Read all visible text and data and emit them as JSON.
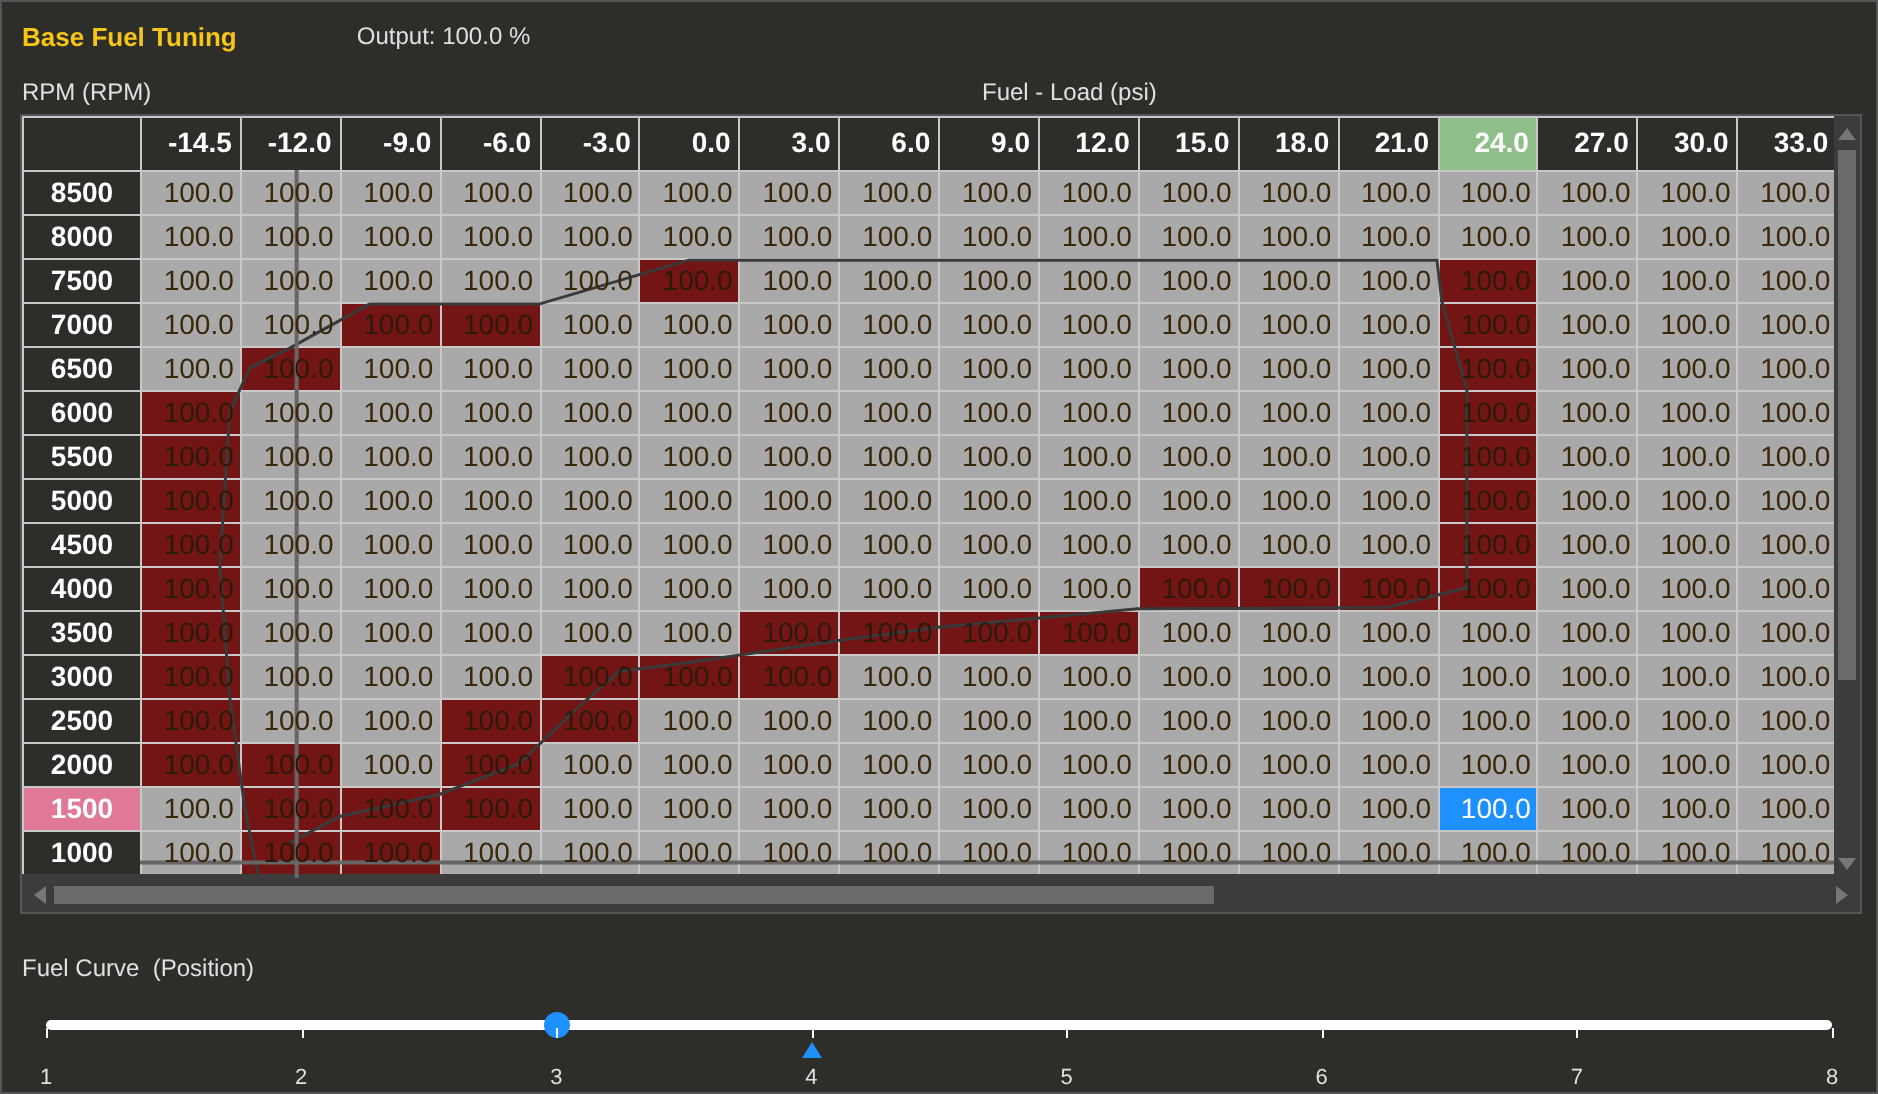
{
  "header": {
    "title": "Base Fuel Tuning",
    "output": "Output: 100.0 %"
  },
  "table": {
    "row_axis": "RPM (RPM)",
    "column_axis": "Fuel - Load (psi)",
    "columns": [
      {
        "label": "-14.5",
        "selected": false
      },
      {
        "label": "-12.0",
        "selected": false
      },
      {
        "label": "-9.0",
        "selected": false
      },
      {
        "label": "-6.0",
        "selected": false
      },
      {
        "label": "-3.0",
        "selected": false
      },
      {
        "label": "0.0",
        "selected": false
      },
      {
        "label": "3.0",
        "selected": false
      },
      {
        "label": "6.0",
        "selected": false
      },
      {
        "label": "9.0",
        "selected": false
      },
      {
        "label": "12.0",
        "selected": false
      },
      {
        "label": "15.0",
        "selected": false
      },
      {
        "label": "18.0",
        "selected": false
      },
      {
        "label": "21.0",
        "selected": false
      },
      {
        "label": "24.0",
        "selected": true
      },
      {
        "label": "27.0",
        "selected": false
      },
      {
        "label": "30.0",
        "selected": false
      },
      {
        "label": "33.0",
        "selected": false
      }
    ],
    "rows": [
      {
        "label": "8500",
        "selected": false,
        "cells": [
          {
            "value": "100.0",
            "hit": false,
            "selected": false
          },
          {
            "value": "100.0",
            "hit": false,
            "selected": false
          },
          {
            "value": "100.0",
            "hit": false,
            "selected": false
          },
          {
            "value": "100.0",
            "hit": false,
            "selected": false
          },
          {
            "value": "100.0",
            "hit": false,
            "selected": false
          },
          {
            "value": "100.0",
            "hit": false,
            "selected": false
          },
          {
            "value": "100.0",
            "hit": false,
            "selected": false
          },
          {
            "value": "100.0",
            "hit": false,
            "selected": false
          },
          {
            "value": "100.0",
            "hit": false,
            "selected": false
          },
          {
            "value": "100.0",
            "hit": false,
            "selected": false
          },
          {
            "value": "100.0",
            "hit": false,
            "selected": false
          },
          {
            "value": "100.0",
            "hit": false,
            "selected": false
          },
          {
            "value": "100.0",
            "hit": false,
            "selected": false
          },
          {
            "value": "100.0",
            "hit": false,
            "selected": false
          },
          {
            "value": "100.0",
            "hit": false,
            "selected": false
          },
          {
            "value": "100.0",
            "hit": false,
            "selected": false
          },
          {
            "value": "100.0",
            "hit": false,
            "selected": false
          }
        ]
      },
      {
        "label": "8000",
        "selected": false,
        "cells": [
          {
            "value": "100.0",
            "hit": false,
            "selected": false
          },
          {
            "value": "100.0",
            "hit": false,
            "selected": false
          },
          {
            "value": "100.0",
            "hit": false,
            "selected": false
          },
          {
            "value": "100.0",
            "hit": false,
            "selected": false
          },
          {
            "value": "100.0",
            "hit": false,
            "selected": false
          },
          {
            "value": "100.0",
            "hit": false,
            "selected": false
          },
          {
            "value": "100.0",
            "hit": false,
            "selected": false
          },
          {
            "value": "100.0",
            "hit": false,
            "selected": false
          },
          {
            "value": "100.0",
            "hit": false,
            "selected": false
          },
          {
            "value": "100.0",
            "hit": false,
            "selected": false
          },
          {
            "value": "100.0",
            "hit": false,
            "selected": false
          },
          {
            "value": "100.0",
            "hit": false,
            "selected": false
          },
          {
            "value": "100.0",
            "hit": false,
            "selected": false
          },
          {
            "value": "100.0",
            "hit": false,
            "selected": false
          },
          {
            "value": "100.0",
            "hit": false,
            "selected": false
          },
          {
            "value": "100.0",
            "hit": false,
            "selected": false
          },
          {
            "value": "100.0",
            "hit": false,
            "selected": false
          }
        ]
      },
      {
        "label": "7500",
        "selected": false,
        "cells": [
          {
            "value": "100.0",
            "hit": false,
            "selected": false
          },
          {
            "value": "100.0",
            "hit": false,
            "selected": false
          },
          {
            "value": "100.0",
            "hit": false,
            "selected": false
          },
          {
            "value": "100.0",
            "hit": false,
            "selected": false
          },
          {
            "value": "100.0",
            "hit": false,
            "selected": false
          },
          {
            "value": "100.0",
            "hit": true,
            "selected": false
          },
          {
            "value": "100.0",
            "hit": false,
            "selected": false
          },
          {
            "value": "100.0",
            "hit": false,
            "selected": false
          },
          {
            "value": "100.0",
            "hit": false,
            "selected": false
          },
          {
            "value": "100.0",
            "hit": false,
            "selected": false
          },
          {
            "value": "100.0",
            "hit": false,
            "selected": false
          },
          {
            "value": "100.0",
            "hit": false,
            "selected": false
          },
          {
            "value": "100.0",
            "hit": false,
            "selected": false
          },
          {
            "value": "100.0",
            "hit": true,
            "selected": false
          },
          {
            "value": "100.0",
            "hit": false,
            "selected": false
          },
          {
            "value": "100.0",
            "hit": false,
            "selected": false
          },
          {
            "value": "100.0",
            "hit": false,
            "selected": false
          }
        ]
      },
      {
        "label": "7000",
        "selected": false,
        "cells": [
          {
            "value": "100.0",
            "hit": false,
            "selected": false
          },
          {
            "value": "100.0",
            "hit": false,
            "selected": false
          },
          {
            "value": "100.0",
            "hit": true,
            "selected": false
          },
          {
            "value": "100.0",
            "hit": true,
            "selected": false
          },
          {
            "value": "100.0",
            "hit": false,
            "selected": false
          },
          {
            "value": "100.0",
            "hit": false,
            "selected": false
          },
          {
            "value": "100.0",
            "hit": false,
            "selected": false
          },
          {
            "value": "100.0",
            "hit": false,
            "selected": false
          },
          {
            "value": "100.0",
            "hit": false,
            "selected": false
          },
          {
            "value": "100.0",
            "hit": false,
            "selected": false
          },
          {
            "value": "100.0",
            "hit": false,
            "selected": false
          },
          {
            "value": "100.0",
            "hit": false,
            "selected": false
          },
          {
            "value": "100.0",
            "hit": false,
            "selected": false
          },
          {
            "value": "100.0",
            "hit": true,
            "selected": false
          },
          {
            "value": "100.0",
            "hit": false,
            "selected": false
          },
          {
            "value": "100.0",
            "hit": false,
            "selected": false
          },
          {
            "value": "100.0",
            "hit": false,
            "selected": false
          }
        ]
      },
      {
        "label": "6500",
        "selected": false,
        "cells": [
          {
            "value": "100.0",
            "hit": false,
            "selected": false
          },
          {
            "value": "100.0",
            "hit": true,
            "selected": false
          },
          {
            "value": "100.0",
            "hit": false,
            "selected": false
          },
          {
            "value": "100.0",
            "hit": false,
            "selected": false
          },
          {
            "value": "100.0",
            "hit": false,
            "selected": false
          },
          {
            "value": "100.0",
            "hit": false,
            "selected": false
          },
          {
            "value": "100.0",
            "hit": false,
            "selected": false
          },
          {
            "value": "100.0",
            "hit": false,
            "selected": false
          },
          {
            "value": "100.0",
            "hit": false,
            "selected": false
          },
          {
            "value": "100.0",
            "hit": false,
            "selected": false
          },
          {
            "value": "100.0",
            "hit": false,
            "selected": false
          },
          {
            "value": "100.0",
            "hit": false,
            "selected": false
          },
          {
            "value": "100.0",
            "hit": false,
            "selected": false
          },
          {
            "value": "100.0",
            "hit": true,
            "selected": false
          },
          {
            "value": "100.0",
            "hit": false,
            "selected": false
          },
          {
            "value": "100.0",
            "hit": false,
            "selected": false
          },
          {
            "value": "100.0",
            "hit": false,
            "selected": false
          }
        ]
      },
      {
        "label": "6000",
        "selected": false,
        "cells": [
          {
            "value": "100.0",
            "hit": true,
            "selected": false
          },
          {
            "value": "100.0",
            "hit": false,
            "selected": false
          },
          {
            "value": "100.0",
            "hit": false,
            "selected": false
          },
          {
            "value": "100.0",
            "hit": false,
            "selected": false
          },
          {
            "value": "100.0",
            "hit": false,
            "selected": false
          },
          {
            "value": "100.0",
            "hit": false,
            "selected": false
          },
          {
            "value": "100.0",
            "hit": false,
            "selected": false
          },
          {
            "value": "100.0",
            "hit": false,
            "selected": false
          },
          {
            "value": "100.0",
            "hit": false,
            "selected": false
          },
          {
            "value": "100.0",
            "hit": false,
            "selected": false
          },
          {
            "value": "100.0",
            "hit": false,
            "selected": false
          },
          {
            "value": "100.0",
            "hit": false,
            "selected": false
          },
          {
            "value": "100.0",
            "hit": false,
            "selected": false
          },
          {
            "value": "100.0",
            "hit": true,
            "selected": false
          },
          {
            "value": "100.0",
            "hit": false,
            "selected": false
          },
          {
            "value": "100.0",
            "hit": false,
            "selected": false
          },
          {
            "value": "100.0",
            "hit": false,
            "selected": false
          }
        ]
      },
      {
        "label": "5500",
        "selected": false,
        "cells": [
          {
            "value": "100.0",
            "hit": true,
            "selected": false
          },
          {
            "value": "100.0",
            "hit": false,
            "selected": false
          },
          {
            "value": "100.0",
            "hit": false,
            "selected": false
          },
          {
            "value": "100.0",
            "hit": false,
            "selected": false
          },
          {
            "value": "100.0",
            "hit": false,
            "selected": false
          },
          {
            "value": "100.0",
            "hit": false,
            "selected": false
          },
          {
            "value": "100.0",
            "hit": false,
            "selected": false
          },
          {
            "value": "100.0",
            "hit": false,
            "selected": false
          },
          {
            "value": "100.0",
            "hit": false,
            "selected": false
          },
          {
            "value": "100.0",
            "hit": false,
            "selected": false
          },
          {
            "value": "100.0",
            "hit": false,
            "selected": false
          },
          {
            "value": "100.0",
            "hit": false,
            "selected": false
          },
          {
            "value": "100.0",
            "hit": false,
            "selected": false
          },
          {
            "value": "100.0",
            "hit": true,
            "selected": false
          },
          {
            "value": "100.0",
            "hit": false,
            "selected": false
          },
          {
            "value": "100.0",
            "hit": false,
            "selected": false
          },
          {
            "value": "100.0",
            "hit": false,
            "selected": false
          }
        ]
      },
      {
        "label": "5000",
        "selected": false,
        "cells": [
          {
            "value": "100.0",
            "hit": true,
            "selected": false
          },
          {
            "value": "100.0",
            "hit": false,
            "selected": false
          },
          {
            "value": "100.0",
            "hit": false,
            "selected": false
          },
          {
            "value": "100.0",
            "hit": false,
            "selected": false
          },
          {
            "value": "100.0",
            "hit": false,
            "selected": false
          },
          {
            "value": "100.0",
            "hit": false,
            "selected": false
          },
          {
            "value": "100.0",
            "hit": false,
            "selected": false
          },
          {
            "value": "100.0",
            "hit": false,
            "selected": false
          },
          {
            "value": "100.0",
            "hit": false,
            "selected": false
          },
          {
            "value": "100.0",
            "hit": false,
            "selected": false
          },
          {
            "value": "100.0",
            "hit": false,
            "selected": false
          },
          {
            "value": "100.0",
            "hit": false,
            "selected": false
          },
          {
            "value": "100.0",
            "hit": false,
            "selected": false
          },
          {
            "value": "100.0",
            "hit": true,
            "selected": false
          },
          {
            "value": "100.0",
            "hit": false,
            "selected": false
          },
          {
            "value": "100.0",
            "hit": false,
            "selected": false
          },
          {
            "value": "100.0",
            "hit": false,
            "selected": false
          }
        ]
      },
      {
        "label": "4500",
        "selected": false,
        "cells": [
          {
            "value": "100.0",
            "hit": true,
            "selected": false
          },
          {
            "value": "100.0",
            "hit": false,
            "selected": false
          },
          {
            "value": "100.0",
            "hit": false,
            "selected": false
          },
          {
            "value": "100.0",
            "hit": false,
            "selected": false
          },
          {
            "value": "100.0",
            "hit": false,
            "selected": false
          },
          {
            "value": "100.0",
            "hit": false,
            "selected": false
          },
          {
            "value": "100.0",
            "hit": false,
            "selected": false
          },
          {
            "value": "100.0",
            "hit": false,
            "selected": false
          },
          {
            "value": "100.0",
            "hit": false,
            "selected": false
          },
          {
            "value": "100.0",
            "hit": false,
            "selected": false
          },
          {
            "value": "100.0",
            "hit": false,
            "selected": false
          },
          {
            "value": "100.0",
            "hit": false,
            "selected": false
          },
          {
            "value": "100.0",
            "hit": false,
            "selected": false
          },
          {
            "value": "100.0",
            "hit": true,
            "selected": false
          },
          {
            "value": "100.0",
            "hit": false,
            "selected": false
          },
          {
            "value": "100.0",
            "hit": false,
            "selected": false
          },
          {
            "value": "100.0",
            "hit": false,
            "selected": false
          }
        ]
      },
      {
        "label": "4000",
        "selected": false,
        "cells": [
          {
            "value": "100.0",
            "hit": true,
            "selected": false
          },
          {
            "value": "100.0",
            "hit": false,
            "selected": false
          },
          {
            "value": "100.0",
            "hit": false,
            "selected": false
          },
          {
            "value": "100.0",
            "hit": false,
            "selected": false
          },
          {
            "value": "100.0",
            "hit": false,
            "selected": false
          },
          {
            "value": "100.0",
            "hit": false,
            "selected": false
          },
          {
            "value": "100.0",
            "hit": false,
            "selected": false
          },
          {
            "value": "100.0",
            "hit": false,
            "selected": false
          },
          {
            "value": "100.0",
            "hit": false,
            "selected": false
          },
          {
            "value": "100.0",
            "hit": false,
            "selected": false
          },
          {
            "value": "100.0",
            "hit": true,
            "selected": false
          },
          {
            "value": "100.0",
            "hit": true,
            "selected": false
          },
          {
            "value": "100.0",
            "hit": true,
            "selected": false
          },
          {
            "value": "100.0",
            "hit": true,
            "selected": false
          },
          {
            "value": "100.0",
            "hit": false,
            "selected": false
          },
          {
            "value": "100.0",
            "hit": false,
            "selected": false
          },
          {
            "value": "100.0",
            "hit": false,
            "selected": false
          }
        ]
      },
      {
        "label": "3500",
        "selected": false,
        "cells": [
          {
            "value": "100.0",
            "hit": true,
            "selected": false
          },
          {
            "value": "100.0",
            "hit": false,
            "selected": false
          },
          {
            "value": "100.0",
            "hit": false,
            "selected": false
          },
          {
            "value": "100.0",
            "hit": false,
            "selected": false
          },
          {
            "value": "100.0",
            "hit": false,
            "selected": false
          },
          {
            "value": "100.0",
            "hit": false,
            "selected": false
          },
          {
            "value": "100.0",
            "hit": true,
            "selected": false
          },
          {
            "value": "100.0",
            "hit": true,
            "selected": false
          },
          {
            "value": "100.0",
            "hit": true,
            "selected": false
          },
          {
            "value": "100.0",
            "hit": true,
            "selected": false
          },
          {
            "value": "100.0",
            "hit": false,
            "selected": false
          },
          {
            "value": "100.0",
            "hit": false,
            "selected": false
          },
          {
            "value": "100.0",
            "hit": false,
            "selected": false
          },
          {
            "value": "100.0",
            "hit": false,
            "selected": false
          },
          {
            "value": "100.0",
            "hit": false,
            "selected": false
          },
          {
            "value": "100.0",
            "hit": false,
            "selected": false
          },
          {
            "value": "100.0",
            "hit": false,
            "selected": false
          }
        ]
      },
      {
        "label": "3000",
        "selected": false,
        "cells": [
          {
            "value": "100.0",
            "hit": true,
            "selected": false
          },
          {
            "value": "100.0",
            "hit": false,
            "selected": false
          },
          {
            "value": "100.0",
            "hit": false,
            "selected": false
          },
          {
            "value": "100.0",
            "hit": false,
            "selected": false
          },
          {
            "value": "100.0",
            "hit": true,
            "selected": false
          },
          {
            "value": "100.0",
            "hit": true,
            "selected": false
          },
          {
            "value": "100.0",
            "hit": true,
            "selected": false
          },
          {
            "value": "100.0",
            "hit": false,
            "selected": false
          },
          {
            "value": "100.0",
            "hit": false,
            "selected": false
          },
          {
            "value": "100.0",
            "hit": false,
            "selected": false
          },
          {
            "value": "100.0",
            "hit": false,
            "selected": false
          },
          {
            "value": "100.0",
            "hit": false,
            "selected": false
          },
          {
            "value": "100.0",
            "hit": false,
            "selected": false
          },
          {
            "value": "100.0",
            "hit": false,
            "selected": false
          },
          {
            "value": "100.0",
            "hit": false,
            "selected": false
          },
          {
            "value": "100.0",
            "hit": false,
            "selected": false
          },
          {
            "value": "100.0",
            "hit": false,
            "selected": false
          }
        ]
      },
      {
        "label": "2500",
        "selected": false,
        "cells": [
          {
            "value": "100.0",
            "hit": true,
            "selected": false
          },
          {
            "value": "100.0",
            "hit": false,
            "selected": false
          },
          {
            "value": "100.0",
            "hit": false,
            "selected": false
          },
          {
            "value": "100.0",
            "hit": true,
            "selected": false
          },
          {
            "value": "100.0",
            "hit": true,
            "selected": false
          },
          {
            "value": "100.0",
            "hit": false,
            "selected": false
          },
          {
            "value": "100.0",
            "hit": false,
            "selected": false
          },
          {
            "value": "100.0",
            "hit": false,
            "selected": false
          },
          {
            "value": "100.0",
            "hit": false,
            "selected": false
          },
          {
            "value": "100.0",
            "hit": false,
            "selected": false
          },
          {
            "value": "100.0",
            "hit": false,
            "selected": false
          },
          {
            "value": "100.0",
            "hit": false,
            "selected": false
          },
          {
            "value": "100.0",
            "hit": false,
            "selected": false
          },
          {
            "value": "100.0",
            "hit": false,
            "selected": false
          },
          {
            "value": "100.0",
            "hit": false,
            "selected": false
          },
          {
            "value": "100.0",
            "hit": false,
            "selected": false
          },
          {
            "value": "100.0",
            "hit": false,
            "selected": false
          }
        ]
      },
      {
        "label": "2000",
        "selected": false,
        "cells": [
          {
            "value": "100.0",
            "hit": true,
            "selected": false
          },
          {
            "value": "100.0",
            "hit": true,
            "selected": false
          },
          {
            "value": "100.0",
            "hit": false,
            "selected": false
          },
          {
            "value": "100.0",
            "hit": true,
            "selected": false
          },
          {
            "value": "100.0",
            "hit": false,
            "selected": false
          },
          {
            "value": "100.0",
            "hit": false,
            "selected": false
          },
          {
            "value": "100.0",
            "hit": false,
            "selected": false
          },
          {
            "value": "100.0",
            "hit": false,
            "selected": false
          },
          {
            "value": "100.0",
            "hit": false,
            "selected": false
          },
          {
            "value": "100.0",
            "hit": false,
            "selected": false
          },
          {
            "value": "100.0",
            "hit": false,
            "selected": false
          },
          {
            "value": "100.0",
            "hit": false,
            "selected": false
          },
          {
            "value": "100.0",
            "hit": false,
            "selected": false
          },
          {
            "value": "100.0",
            "hit": false,
            "selected": false
          },
          {
            "value": "100.0",
            "hit": false,
            "selected": false
          },
          {
            "value": "100.0",
            "hit": false,
            "selected": false
          },
          {
            "value": "100.0",
            "hit": false,
            "selected": false
          }
        ]
      },
      {
        "label": "1500",
        "selected": true,
        "cells": [
          {
            "value": "100.0",
            "hit": false,
            "selected": false
          },
          {
            "value": "100.0",
            "hit": true,
            "selected": false
          },
          {
            "value": "100.0",
            "hit": true,
            "selected": false
          },
          {
            "value": "100.0",
            "hit": true,
            "selected": false
          },
          {
            "value": "100.0",
            "hit": false,
            "selected": false
          },
          {
            "value": "100.0",
            "hit": false,
            "selected": false
          },
          {
            "value": "100.0",
            "hit": false,
            "selected": false
          },
          {
            "value": "100.0",
            "hit": false,
            "selected": false
          },
          {
            "value": "100.0",
            "hit": false,
            "selected": false
          },
          {
            "value": "100.0",
            "hit": false,
            "selected": false
          },
          {
            "value": "100.0",
            "hit": false,
            "selected": false
          },
          {
            "value": "100.0",
            "hit": false,
            "selected": false
          },
          {
            "value": "100.0",
            "hit": false,
            "selected": false
          },
          {
            "value": "100.0",
            "hit": false,
            "selected": true
          },
          {
            "value": "100.0",
            "hit": false,
            "selected": false
          },
          {
            "value": "100.0",
            "hit": false,
            "selected": false
          },
          {
            "value": "100.0",
            "hit": false,
            "selected": false
          }
        ]
      },
      {
        "label": "1000",
        "selected": false,
        "cells": [
          {
            "value": "100.0",
            "hit": false,
            "selected": false
          },
          {
            "value": "100.0",
            "hit": true,
            "selected": false
          },
          {
            "value": "100.0",
            "hit": true,
            "selected": false
          },
          {
            "value": "100.0",
            "hit": false,
            "selected": false
          },
          {
            "value": "100.0",
            "hit": false,
            "selected": false
          },
          {
            "value": "100.0",
            "hit": false,
            "selected": false
          },
          {
            "value": "100.0",
            "hit": false,
            "selected": false
          },
          {
            "value": "100.0",
            "hit": false,
            "selected": false
          },
          {
            "value": "100.0",
            "hit": false,
            "selected": false
          },
          {
            "value": "100.0",
            "hit": false,
            "selected": false
          },
          {
            "value": "100.0",
            "hit": false,
            "selected": false
          },
          {
            "value": "100.0",
            "hit": false,
            "selected": false
          },
          {
            "value": "100.0",
            "hit": false,
            "selected": false
          },
          {
            "value": "100.0",
            "hit": false,
            "selected": false
          },
          {
            "value": "100.0",
            "hit": false,
            "selected": false
          },
          {
            "value": "100.0",
            "hit": false,
            "selected": false
          },
          {
            "value": "100.0",
            "hit": false,
            "selected": false
          }
        ]
      }
    ]
  },
  "slider": {
    "label": "Fuel Curve  (Position)",
    "level": 0.2857,
    "ticks": [
      {
        "label": "1",
        "marked": false
      },
      {
        "label": "2",
        "marked": false
      },
      {
        "label": "3",
        "marked": false
      },
      {
        "label": "4",
        "marked": true
      },
      {
        "label": "5",
        "marked": false
      },
      {
        "label": "6",
        "marked": false
      },
      {
        "label": "7",
        "marked": false
      },
      {
        "label": "8",
        "marked": false
      }
    ]
  }
}
